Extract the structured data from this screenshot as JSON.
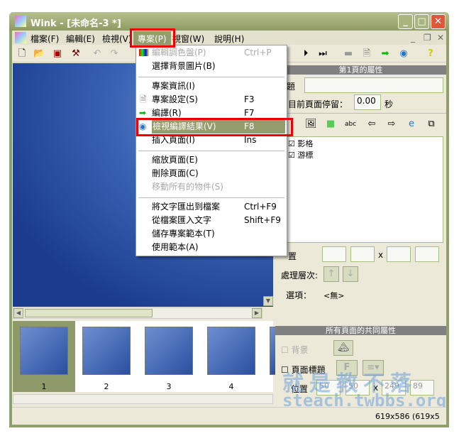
{
  "window": {
    "title": "Wink - [未命名-3 *]"
  },
  "menubar": [
    "檔案(F)",
    "編輯(E)",
    "檢視(V)",
    "專案(P)",
    "視窗(W)",
    "說明(H)"
  ],
  "project_menu": {
    "items": [
      {
        "label": "編輯調色盤(P)",
        "shortcut": "Ctrl+P",
        "disabled": true
      },
      {
        "label": "選擇背景圖片(B)",
        "shortcut": ""
      },
      {
        "label": "專案資訊(I)",
        "shortcut": ""
      },
      {
        "label": "專案設定(S)",
        "shortcut": "F3"
      },
      {
        "label": "編譯(R)",
        "shortcut": "F7"
      },
      {
        "label": "檢視編譯結果(V)",
        "shortcut": "F8",
        "highlighted": true
      },
      {
        "label": "插入頁面(I)",
        "shortcut": "Ins"
      },
      {
        "label": "縮放頁面(E)",
        "shortcut": ""
      },
      {
        "label": "刪除頁面(C)",
        "shortcut": ""
      },
      {
        "label": "移動所有的物件(S)",
        "shortcut": "",
        "disabled": true
      },
      {
        "label": "將文字匯出到檔案",
        "shortcut": "Ctrl+F9"
      },
      {
        "label": "從檔案匯入文字",
        "shortcut": "Shift+F9"
      },
      {
        "label": "儲存專案範本(T)",
        "shortcut": ""
      },
      {
        "label": "使用範本(A)",
        "shortcut": ""
      }
    ]
  },
  "thumbnails": [
    "1",
    "2",
    "3",
    "4"
  ],
  "page_props": {
    "header": "第1頁的屬性",
    "title_label": "題",
    "stay_label": "目前頁面停留：",
    "stay_value": "0.00",
    "stay_unit": "秒",
    "objects": [
      "影格",
      "游標"
    ],
    "position_label": "置",
    "x_label": "x",
    "layer_label": "處理層次:",
    "options_label": "選項：",
    "options_value": "<無>"
  },
  "common_props": {
    "header": "所有頁面的共同屬性",
    "background_label": "背景",
    "page_title_label": "頁面標題",
    "font_btn": "F",
    "position_label": "位置",
    "pos": [
      "50",
      "50",
      "249",
      "89"
    ],
    "x_label": "x"
  },
  "status": {
    "size": "619x586 (619x5"
  },
  "watermark": {
    "cn": "就是教不落",
    "url": "steach.twbbs.org"
  }
}
